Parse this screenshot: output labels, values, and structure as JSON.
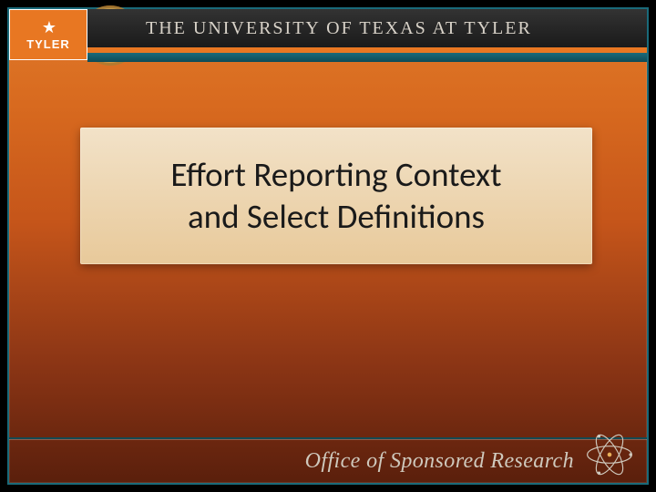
{
  "header": {
    "logo_label": "TYLER",
    "university_name": "THE UNIVERSITY OF TEXAS AT TYLER"
  },
  "content": {
    "title_line1": "Effort Reporting Context",
    "title_line2": "and Select Definitions"
  },
  "footer": {
    "office_label": "Office of Sponsored Research"
  },
  "colors": {
    "brand_orange": "#e87722",
    "brand_teal": "#1a6a7a",
    "card_bg_top": "#f2e2c8",
    "card_bg_bottom": "#e8c99a"
  }
}
